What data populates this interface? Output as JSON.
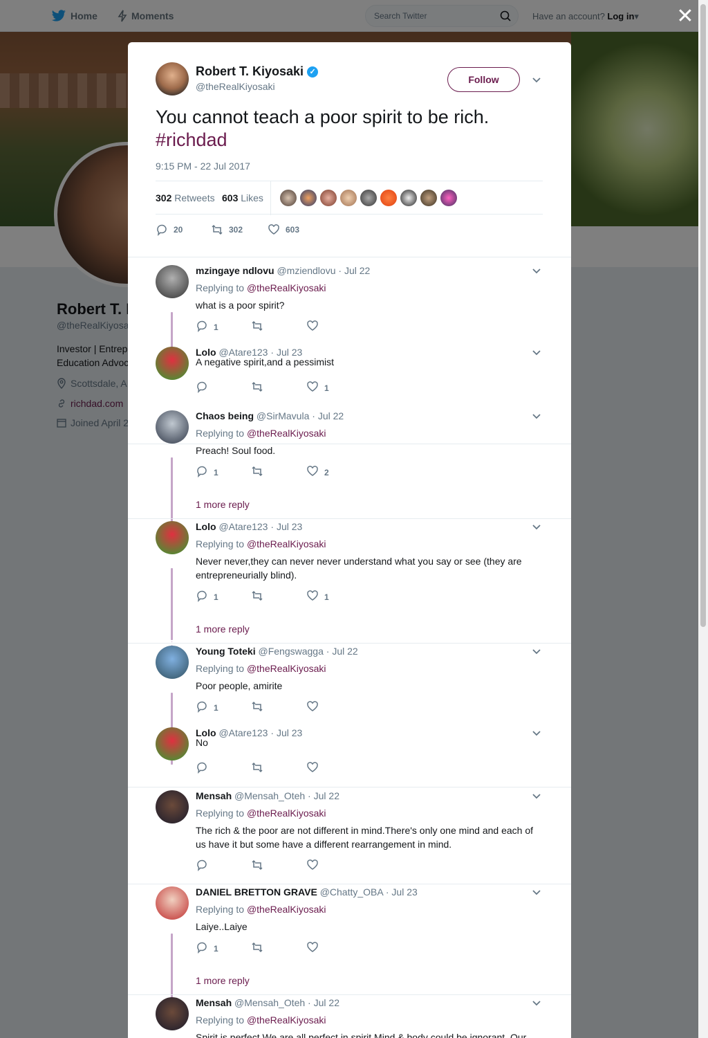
{
  "nav": {
    "home": "Home",
    "moments": "Moments",
    "search_placeholder": "Search Twitter",
    "have_account": "Have an account?",
    "login": "Log in"
  },
  "profile": {
    "name": "Robert T. K",
    "handle": "@theRealKiyosak",
    "bio_line1": "Investor | Entrep",
    "bio_line2": "Education Advoc",
    "location": "Scottsdale, A",
    "website": "richdad.com",
    "joined": "Joined April 2"
  },
  "tweet": {
    "author_name": "Robert T. Kiyosaki",
    "author_handle": "@theRealKiyosaki",
    "follow_label": "Follow",
    "text": "You cannot teach a poor spirit to be rich.",
    "hashtag": "#richdad",
    "timestamp": "9:15 PM - 22 Jul 2017",
    "retweets_count": "302",
    "retweets_label": "Retweets",
    "likes_count": "603",
    "likes_label": "Likes",
    "reply_count": "20",
    "retweet_action_count": "302",
    "like_action_count": "603"
  },
  "replies": [
    {
      "name": "mzingaye ndlovu",
      "handle": "@mziendlovu",
      "date": "Jul 22",
      "replying_label": "Replying to",
      "replying_to": "@theRealKiyosaki",
      "text": "what is a poor spirit?",
      "replies": "1",
      "retweets": "",
      "likes": ""
    },
    {
      "name": "Lolo",
      "handle": "@Atare123",
      "date": "Jul 23",
      "text": "A negative spirit,and a pessimist",
      "replies": "",
      "retweets": "",
      "likes": "1"
    },
    {
      "name": "Chaos being",
      "handle": "@SirMavula",
      "date": "Jul 22",
      "replying_label": "Replying to",
      "replying_to": "@theRealKiyosaki",
      "text": "Preach! Soul food.",
      "replies": "1",
      "retweets": "",
      "likes": "2",
      "more": "1 more reply"
    },
    {
      "name": "Lolo",
      "handle": "@Atare123",
      "date": "Jul 23",
      "replying_label": "Replying to",
      "replying_to": "@theRealKiyosaki",
      "text": "Never never,they can never never understand what you say or see (they are entrepreneurially blind).",
      "replies": "1",
      "retweets": "",
      "likes": "1",
      "more": "1 more reply"
    },
    {
      "name": "Young Toteki",
      "handle": "@Fengswagga",
      "date": "Jul 22",
      "replying_label": "Replying to",
      "replying_to": "@theRealKiyosaki",
      "text": "Poor people, amirite",
      "replies": "1",
      "retweets": "",
      "likes": ""
    },
    {
      "name": "Lolo",
      "handle": "@Atare123",
      "date": "Jul 23",
      "text": "No",
      "replies": "",
      "retweets": "",
      "likes": ""
    },
    {
      "name": "Mensah",
      "handle": "@Mensah_Oteh",
      "date": "Jul 22",
      "replying_label": "Replying to",
      "replying_to": "@theRealKiyosaki",
      "text": "The rich & the poor are not different in mind.There's only one mind and each of us have it but some have a different rearrangement in mind.",
      "replies": "",
      "retweets": "",
      "likes": ""
    },
    {
      "name": "DANIEL BRETTON GRAVE",
      "handle": "@Chatty_OBA",
      "date": "Jul 23",
      "replying_label": "Replying to",
      "replying_to": "@theRealKiyosaki",
      "text": "Laiye..Laiye",
      "replies": "1",
      "retweets": "",
      "likes": "",
      "more": "1 more reply"
    },
    {
      "name": "Mensah",
      "handle": "@Mensah_Oteh",
      "date": "Jul 22",
      "replying_label": "Replying to",
      "replying_to": "@theRealKiyosaki",
      "text": "Spirit is perfect.We are all perfect in spirit.Mind & body could be ignorant. Our",
      "replies": "",
      "retweets": "",
      "likes": ""
    }
  ],
  "colors": {
    "accent": "#6a1b4d",
    "twitter_blue": "#1da1f2",
    "thread_line": "#c5a5c8"
  }
}
